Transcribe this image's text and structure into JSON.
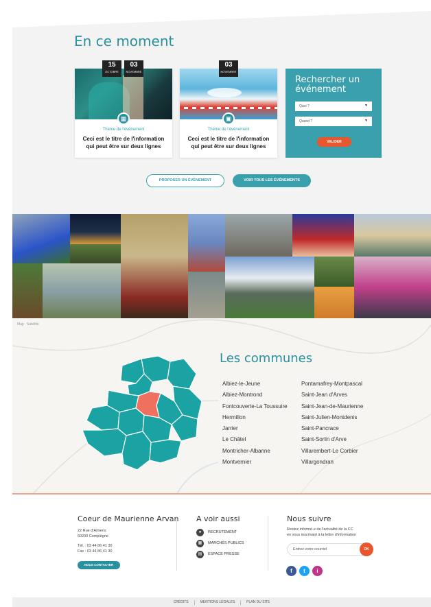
{
  "events": {
    "title": "En ce moment",
    "cards": [
      {
        "day": "15",
        "month": "Octobre",
        "theme": "Thème de l'événement",
        "title": "Ceci est le titre de l'information qui peut être sur deux lignes"
      },
      {
        "day": "03",
        "month": "Novembre",
        "theme": "Thème de l'événement",
        "title": "Ceci est le titre de l'information qui peut être sur deux lignes"
      }
    ],
    "card1_end_day": "03",
    "card1_end_month": "Novembre",
    "search": {
      "title": "Rechercher un événement",
      "what_placeholder": "Quoi ?",
      "when_placeholder": "Quand ?",
      "validate": "VALIDER"
    },
    "propose_button": "PROPOSER UN ÉVÉNEMENT",
    "all_button": "VOIR TOUS LES ÉVÉNEMENTS"
  },
  "map": {
    "tab_map": "Map",
    "tab_satellite": "Satellite",
    "title": "Les communes",
    "col1": [
      "Albiez-le-Jeune",
      "Albiez-Montrond",
      "Fontcouverte-La Toussuire",
      "Hermillon",
      "Jarrier",
      "Le Châtel",
      "Montricher-Albanne",
      "Montvernier"
    ],
    "col2": [
      "Pontamafrey-Montpascal",
      "Saint-Jean d'Arves",
      "Saint-Jean-de-Maurienne",
      "Saint-Julien-Montdenis",
      "Saint-Pancrace",
      "Saint-Sorlin d'Arve",
      "Villarembert-Le Corbier",
      "Villargondran"
    ]
  },
  "footer": {
    "org_title": "Coeur de Maurienne Arvan",
    "address1": "22 Rue d'Amiens",
    "address2": "60200 Compiègne",
    "tel": "Tél. : 03 44 86 41 30",
    "fax": "Fax : 03 44 86 41 30",
    "contact_button": "NOUS CONTACTER",
    "see_also_title": "A voir aussi",
    "links": [
      "RECRUTEMENT",
      "MARCHÉS PUBLICS",
      "ESPACE PRESSE"
    ],
    "follow_title": "Nous suivre",
    "follow_text1": "Restez informé-e de l'actualité de la CC",
    "follow_text2": "en vous inscrivant à la lettre d'information",
    "email_placeholder": "Entrez votre courriel",
    "ok": "OK",
    "social": [
      "f",
      "t",
      "i"
    ]
  },
  "bottom": {
    "credits": "CRÉDITS",
    "legal": "MENTIONS LÉGALES",
    "sitemap": "PLAN DU SITE"
  },
  "colors": {
    "accent": "#2a8f9e",
    "orange": "#e8562e",
    "map_teal": "#1ba3a3",
    "map_highlight": "#f07060"
  }
}
